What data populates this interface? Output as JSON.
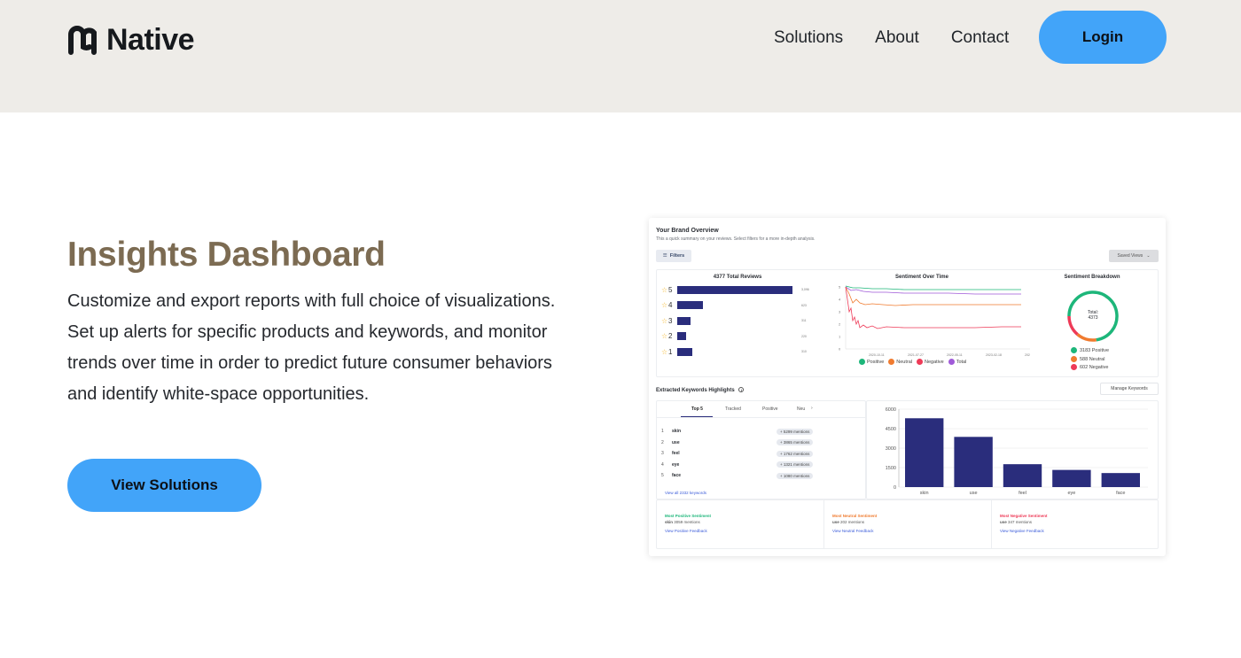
{
  "brand": {
    "name": "Native"
  },
  "nav": {
    "items": [
      "Solutions",
      "About",
      "Contact"
    ],
    "login_label": "Login"
  },
  "hero": {
    "title": "Insights Dashboard",
    "description": "Customize and export reports with full choice of visualizations. Set up alerts for specific products and keywords, and monitor trends over time in order to predict future consumer behaviors and identify white-space opportunities.",
    "cta_label": "View Solutions"
  },
  "colors": {
    "accent": "#42a4f9",
    "title": "#7c6b52",
    "header_bg": "#eeece8",
    "bar": "#2a2d7c",
    "positive": "#1db67a",
    "neutral": "#f07b2f",
    "negative": "#ee3a57",
    "total": "#a05ad8"
  },
  "dashboard": {
    "title": "Your Brand Overview",
    "subtitle": "This a quick summary on your reviews. Select filters for a more in-depth analysis.",
    "filters_label": "Filters",
    "saved_views_label": "Saved Views",
    "reviews": {
      "title": "4377 Total Reviews",
      "rows": [
        {
          "stars": "5",
          "count": "3,096",
          "value": 3096
        },
        {
          "stars": "4",
          "count": "623",
          "value": 690
        },
        {
          "stars": "3",
          "count": "311",
          "value": 360
        },
        {
          "stars": "2",
          "count": "220",
          "value": 240
        },
        {
          "stars": "1",
          "count": "310",
          "value": 400
        }
      ]
    },
    "sentiment_time": {
      "title": "Sentiment Over Time",
      "y_ticks": [
        "5",
        "4",
        "3",
        "2",
        "1",
        "0"
      ],
      "x_ticks": [
        "2020-10-11",
        "2021-07-27",
        "2022-05-11",
        "2023-02-18",
        "2024-01-"
      ],
      "legend": [
        "Positive",
        "Neutral",
        "Negative",
        "Total"
      ]
    },
    "breakdown": {
      "title": "Sentiment Breakdown",
      "center_label": "Total:",
      "center_value": "4373",
      "items": [
        "3183 Positive",
        "588 Neutral",
        "602 Negative"
      ],
      "values": [
        3183,
        588,
        602
      ]
    },
    "keywords": {
      "title": "Extracted Keywords Highlights",
      "manage_label": "Manage Keywords",
      "tabs": [
        "Top 5",
        "Tracked",
        "Positive",
        "Neu"
      ],
      "rows": [
        {
          "idx": "1",
          "word": "skin",
          "mentions": "+ 5299 mentions"
        },
        {
          "idx": "2",
          "word": "use",
          "mentions": "+ 3865 mentions"
        },
        {
          "idx": "3",
          "word": "feel",
          "mentions": "+ 1762 mentions"
        },
        {
          "idx": "4",
          "word": "eye",
          "mentions": "+ 1321 mentions"
        },
        {
          "idx": "5",
          "word": "face",
          "mentions": "+ 1080 mentions"
        }
      ],
      "view_all": "View all 2332 keywords"
    },
    "bottom": [
      {
        "title": "Most Positive Sentiment",
        "word": "skin",
        "stat": "3059 mentions",
        "link": "View Positive Feedback"
      },
      {
        "title": "Most Neutral Sentiment",
        "word": "use",
        "stat": "202 mentions",
        "link": "View Neutral Feedback"
      },
      {
        "title": "Most Negative Sentiment",
        "word": "use",
        "stat": "347 mentions",
        "link": "View Negative Feedback"
      }
    ]
  },
  "chart_data": {
    "type": "bar",
    "categories": [
      "skin",
      "use",
      "feel",
      "eye",
      "face"
    ],
    "values": [
      5299,
      3865,
      1762,
      1321,
      1080
    ],
    "ylim": [
      0,
      6000
    ],
    "y_ticks": [
      "6000",
      "4500",
      "3000",
      "1500",
      "0"
    ],
    "grid": true
  }
}
